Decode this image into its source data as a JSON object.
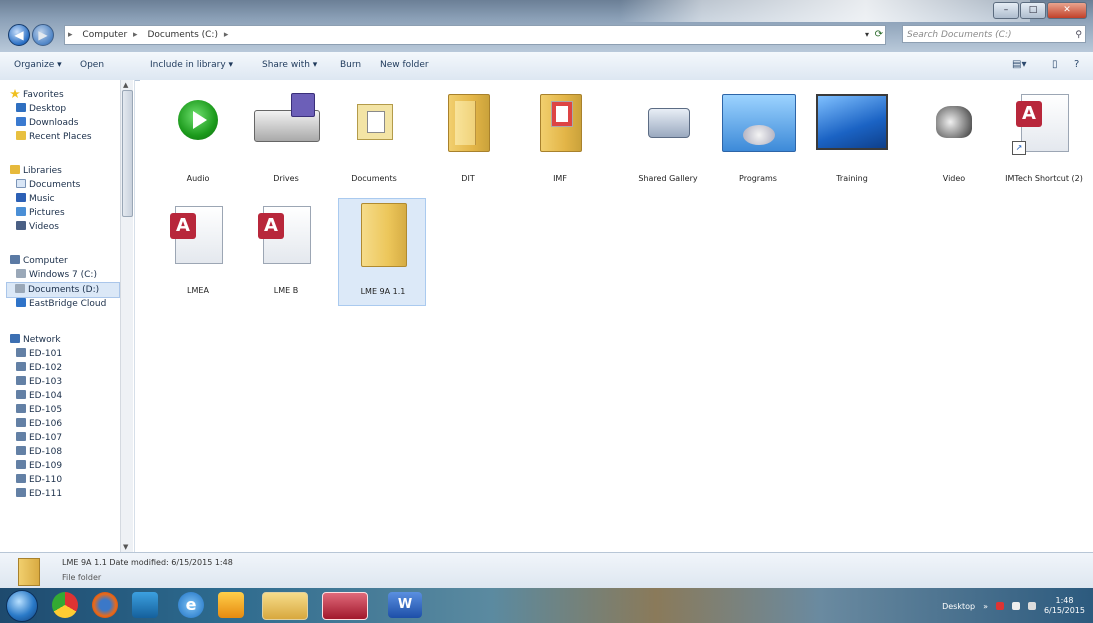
{
  "window": {
    "controls": [
      "–",
      "□",
      "✕"
    ]
  },
  "address": {
    "crumbs": [
      "Computer",
      "Documents (C:)"
    ],
    "search_placeholder": "Search Documents (C:)"
  },
  "commands": {
    "organize": "Organize ▾",
    "open": "Open",
    "include": "Include in library ▾",
    "share": "Share with ▾",
    "burn": "Burn",
    "new_folder": "New folder"
  },
  "nav": {
    "favorites": "Favorites",
    "desktop": "Desktop",
    "downloads": "Downloads",
    "recent": "Recent Places",
    "libraries": "Libraries",
    "documents": "Documents",
    "music": "Music",
    "pictures": "Pictures",
    "videos": "Videos",
    "computer": "Computer",
    "win7": "Windows 7 (C:)",
    "docs_drive": "Documents (D:)",
    "eastbridge": "EastBridge Cloud",
    "network": "Network",
    "pcs": [
      "ED-101",
      "ED-102",
      "ED-103",
      "ED-104",
      "ED-105",
      "ED-106",
      "ED-107",
      "ED-108",
      "ED-109",
      "ED-110",
      "ED-111"
    ]
  },
  "files": [
    {
      "label": "Audio",
      "icon": "audio-icon"
    },
    {
      "label": "Drives",
      "icon": "drive-icon"
    },
    {
      "label": "Documents",
      "icon": "documents-icon"
    },
    {
      "label": "DIT",
      "icon": "folder-icon"
    },
    {
      "label": "IMF",
      "icon": "folder-icon"
    },
    {
      "label": "Shared Gallery",
      "icon": "share-icon"
    },
    {
      "label": "Programs",
      "icon": "programs-icon"
    },
    {
      "label": "Training",
      "icon": "training-icon"
    },
    {
      "label": "Video",
      "icon": "video-icon"
    },
    {
      "label": "IMTech Shortcut (2)",
      "icon": "access-shortcut-icon"
    },
    {
      "label": "LMEA",
      "icon": "access-icon"
    },
    {
      "label": "LME B",
      "icon": "access-icon"
    },
    {
      "label": "LME 9A 1.1",
      "icon": "folder-icon"
    }
  ],
  "details": {
    "title": "LME 9A 1.1   Date modified: 6/15/2015 1:48",
    "type": "File folder"
  },
  "tray": {
    "desktop": "Desktop",
    "time": "1:48",
    "date": "6/15/2015"
  }
}
